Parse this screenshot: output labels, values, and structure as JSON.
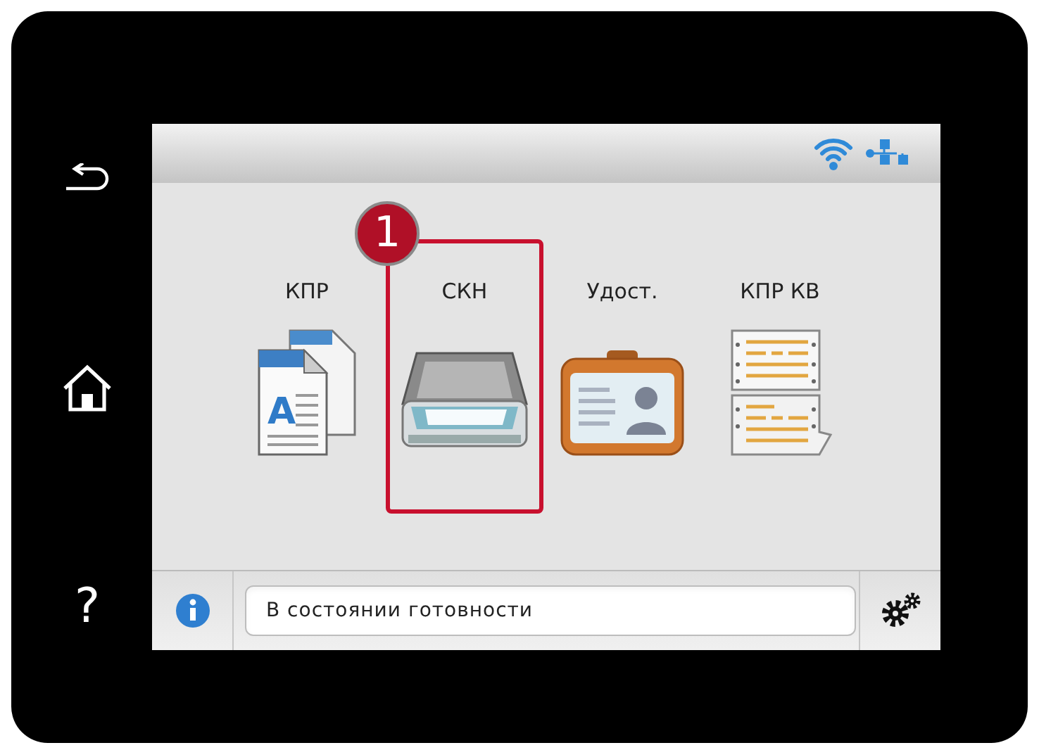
{
  "bezel": {
    "help_key": "?"
  },
  "apps": [
    {
      "label": "КПР",
      "kind": "copy",
      "icon_letter": "A",
      "callout": false
    },
    {
      "label": "СКН",
      "kind": "scan",
      "callout": true
    },
    {
      "label": "Удост.",
      "kind": "id-card",
      "callout": false
    },
    {
      "label": "КПР КВ",
      "kind": "receipt",
      "callout": false
    }
  ],
  "callout": {
    "number": "1"
  },
  "status_bar": {
    "message": "В состоянии готовности"
  }
}
